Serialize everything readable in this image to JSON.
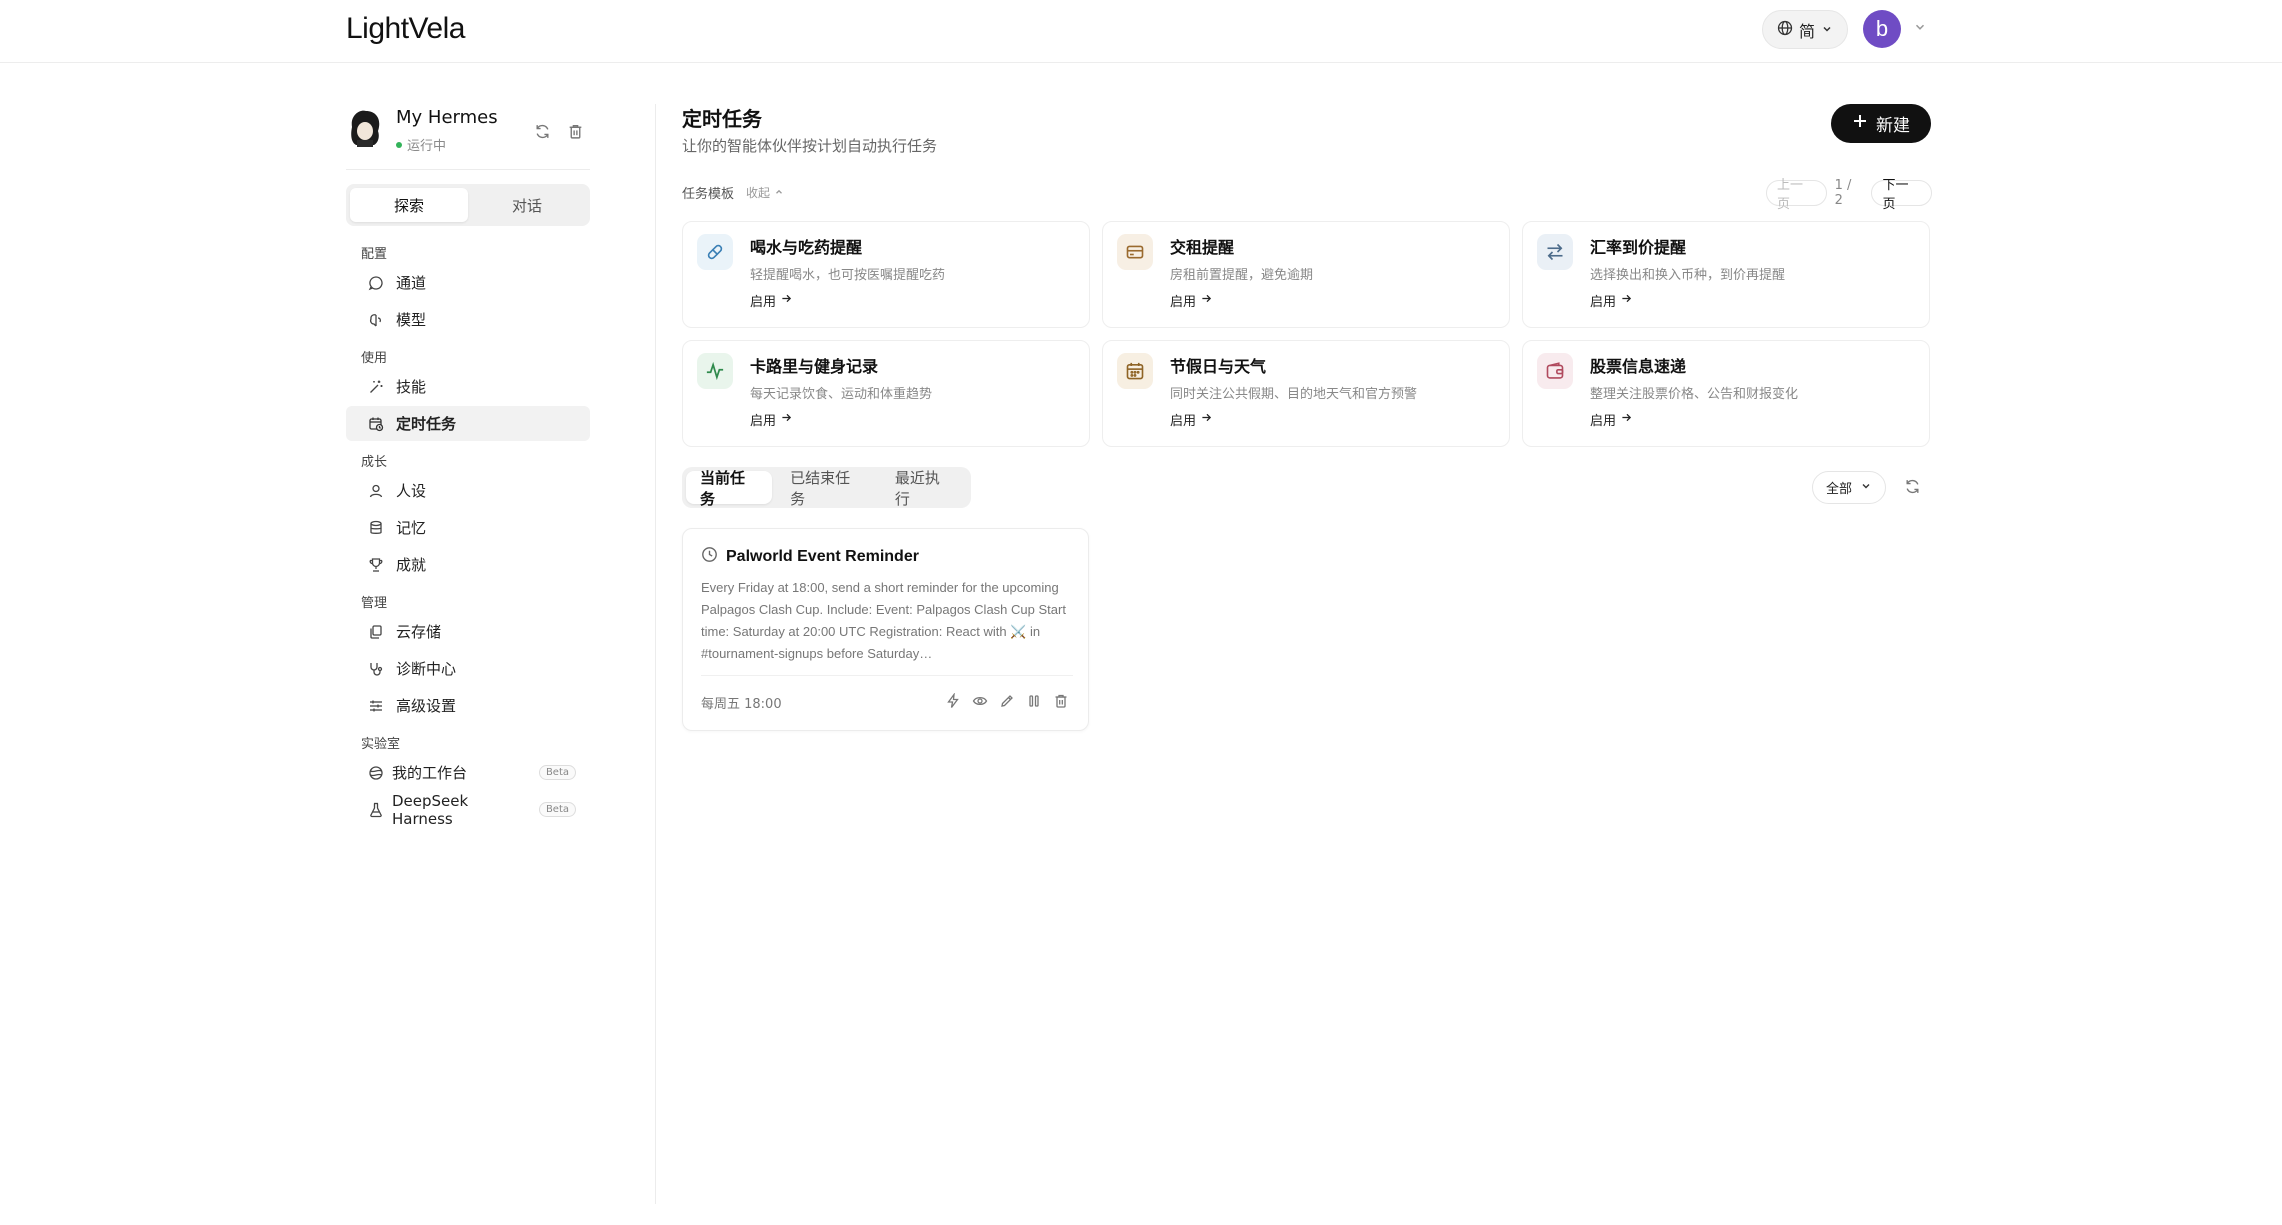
{
  "header": {
    "logo": "LightVela",
    "lang_label": "简",
    "user_initial": "b"
  },
  "agent": {
    "name": "My Hermes",
    "status": "运行中"
  },
  "segment": {
    "explore": "探索",
    "chat": "对话"
  },
  "nav": {
    "sections": {
      "config": "配置",
      "use": "使用",
      "growth": "成长",
      "manage": "管理",
      "lab": "实验室"
    },
    "items": {
      "channel": "通道",
      "model": "模型",
      "skills": "技能",
      "scheduled": "定时任务",
      "persona": "人设",
      "memory": "记忆",
      "achievement": "成就",
      "cloud": "云存储",
      "diagnostics": "诊断中心",
      "advanced": "高级设置",
      "workbench": "我的工作台",
      "deepseek": "DeepSeek Harness"
    },
    "beta": "Beta"
  },
  "page": {
    "title": "定时任务",
    "subtitle": "让你的智能体伙伴按计划自动执行任务",
    "new_button": "新建"
  },
  "templates": {
    "label": "任务模板",
    "collapse": "收起",
    "prev": "上一页",
    "page_info": "1 / 2",
    "next": "下一页",
    "use_label": "启用",
    "items": [
      {
        "title": "喝水与吃药提醒",
        "desc": "轻提醒喝水，也可按医嘱提醒吃药"
      },
      {
        "title": "交租提醒",
        "desc": "房租前置提醒，避免逾期"
      },
      {
        "title": "汇率到价提醒",
        "desc": "选择换出和换入币种，到价再提醒"
      },
      {
        "title": "卡路里与健身记录",
        "desc": "每天记录饮食、运动和体重趋势"
      },
      {
        "title": "节假日与天气",
        "desc": "同时关注公共假期、目的地天气和官方预警"
      },
      {
        "title": "股票信息速递",
        "desc": "整理关注股票价格、公告和财报变化"
      }
    ]
  },
  "tabs": {
    "current": "当前任务",
    "ended": "已结束任务",
    "recent": "最近执行",
    "filter": "全部"
  },
  "task": {
    "title": "Palworld Event Reminder",
    "body": "Every Friday at 18:00, send a short reminder for the upcoming Palpagos Clash Cup. Include: Event: Palpagos Clash Cup Start time: Saturday at 20:00 UTC Registration: React with ⚔️ in #tournament-signups before Saturday…",
    "schedule": "每周五 18:00"
  },
  "colors": {
    "accent": "#111111",
    "avatar": "#6f4cc4",
    "status_green": "#33b35a"
  }
}
